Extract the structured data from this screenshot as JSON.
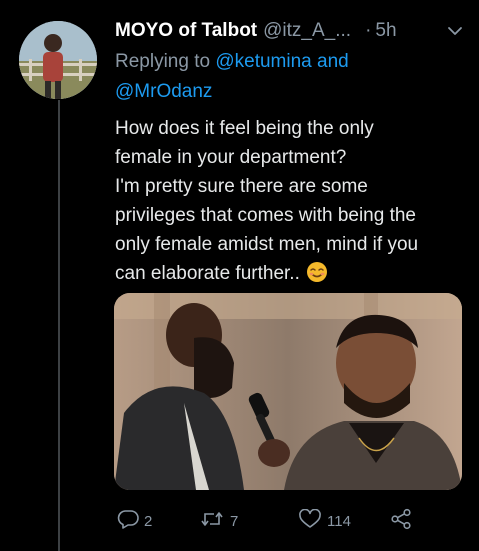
{
  "tweet": {
    "display_name": "MOYO of Talbot",
    "handle": "@itz_A_...",
    "separator": "·",
    "time": "5h",
    "replying_prefix": "Replying to",
    "mention_1": "@ketumina",
    "joiner": "and",
    "mention_2": "@MrOdanz",
    "text_lines": [
      "How does it feel being the only",
      "female in your department?",
      "I'm pretty sure there are some",
      "privileges that comes with being the",
      "only female amidst men, mind if you",
      "can elaborate further.."
    ],
    "emoji": "smiling-face-with-smiling-eyes"
  },
  "actions": {
    "reply_count": "2",
    "retweet_count": "7",
    "like_count": "114"
  },
  "colors": {
    "background": "#000000",
    "text": "#e7e9ea",
    "muted": "#8b98a5",
    "link": "#1d9bf0",
    "thread_line": "#3d4144"
  }
}
